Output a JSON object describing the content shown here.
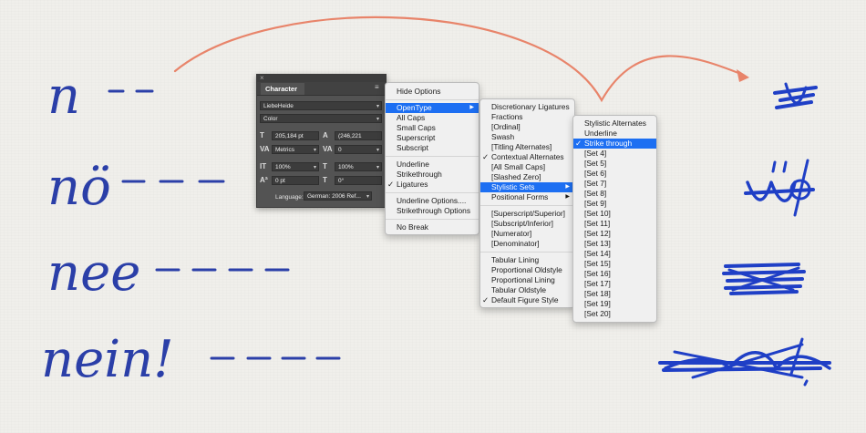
{
  "handwriting": {
    "words": [
      "n",
      "nö",
      "nee",
      "nein!"
    ]
  },
  "character_panel": {
    "title": "Character",
    "close_glyph": "×",
    "menu_glyph": "≡",
    "font_family": "LiebeHeide",
    "font_style": "Color",
    "font_size": "205,184 pt",
    "leading": "(246,221",
    "kerning": "Metrics",
    "tracking": "0",
    "vertical_scale": "100%",
    "horizontal_scale": "100%",
    "baseline_shift": "0 pt",
    "skew": "0°",
    "language_label": "Language:",
    "language": "German: 2006 Ref..."
  },
  "menu1": {
    "items": [
      {
        "label": "Hide Options"
      },
      {
        "label": "OpenType",
        "highlighted": true,
        "submenu": true
      },
      {
        "label": "All Caps"
      },
      {
        "label": "Small Caps"
      },
      {
        "label": "Superscript"
      },
      {
        "label": "Subscript"
      },
      {
        "label": "Underline"
      },
      {
        "label": "Strikethrough"
      },
      {
        "label": "Ligatures",
        "checked": true
      },
      {
        "label": "Underline Options...."
      },
      {
        "label": "Strikethrough Options"
      },
      {
        "label": "No Break"
      }
    ]
  },
  "menu2": {
    "items": [
      {
        "label": "Discretionary Ligatures"
      },
      {
        "label": "Fractions"
      },
      {
        "label": "[Ordinal]"
      },
      {
        "label": "Swash"
      },
      {
        "label": "[Titling Alternates]"
      },
      {
        "label": "Contextual Alternates",
        "checked": true
      },
      {
        "label": "[All Small Caps]"
      },
      {
        "label": "[Slashed Zero]"
      },
      {
        "label": "Stylistic Sets",
        "highlighted": true,
        "submenu": true
      },
      {
        "label": "Positional Forms",
        "submenu": true
      },
      {
        "label": "[Superscript/Superior]"
      },
      {
        "label": "[Subscript/Inferior]"
      },
      {
        "label": "[Numerator]"
      },
      {
        "label": "[Denominator]"
      },
      {
        "label": "Tabular Lining"
      },
      {
        "label": "Proportional Oldstyle"
      },
      {
        "label": "Proportional Lining"
      },
      {
        "label": "Tabular Oldstyle"
      },
      {
        "label": "Default Figure Style",
        "checked": true
      }
    ]
  },
  "menu3": {
    "items": [
      {
        "label": "Stylistic Alternates"
      },
      {
        "label": "Underline"
      },
      {
        "label": "Strike through",
        "highlighted": true,
        "checked": true
      },
      {
        "label": "[Set 4]"
      },
      {
        "label": "[Set 5]"
      },
      {
        "label": "[Set 6]"
      },
      {
        "label": "[Set 7]"
      },
      {
        "label": "[Set 8]"
      },
      {
        "label": "[Set 9]"
      },
      {
        "label": "[Set 10]"
      },
      {
        "label": "[Set 11]"
      },
      {
        "label": "[Set 12]"
      },
      {
        "label": "[Set 13]"
      },
      {
        "label": "[Set 14]"
      },
      {
        "label": "[Set 15]"
      },
      {
        "label": "[Set 16]"
      },
      {
        "label": "[Set 17]"
      },
      {
        "label": "[Set 18]"
      },
      {
        "label": "[Set 19]"
      },
      {
        "label": "[Set 20]"
      }
    ]
  },
  "glyphs": {
    "check": "✓",
    "submenu_arrow": "▶",
    "dropdown": "▾"
  },
  "colors": {
    "ink_blue": "#2b3fa8",
    "scribble_blue": "#1f3fc6",
    "arrow_orange": "#e8846a",
    "menu_highlight": "#1d6ff2"
  }
}
